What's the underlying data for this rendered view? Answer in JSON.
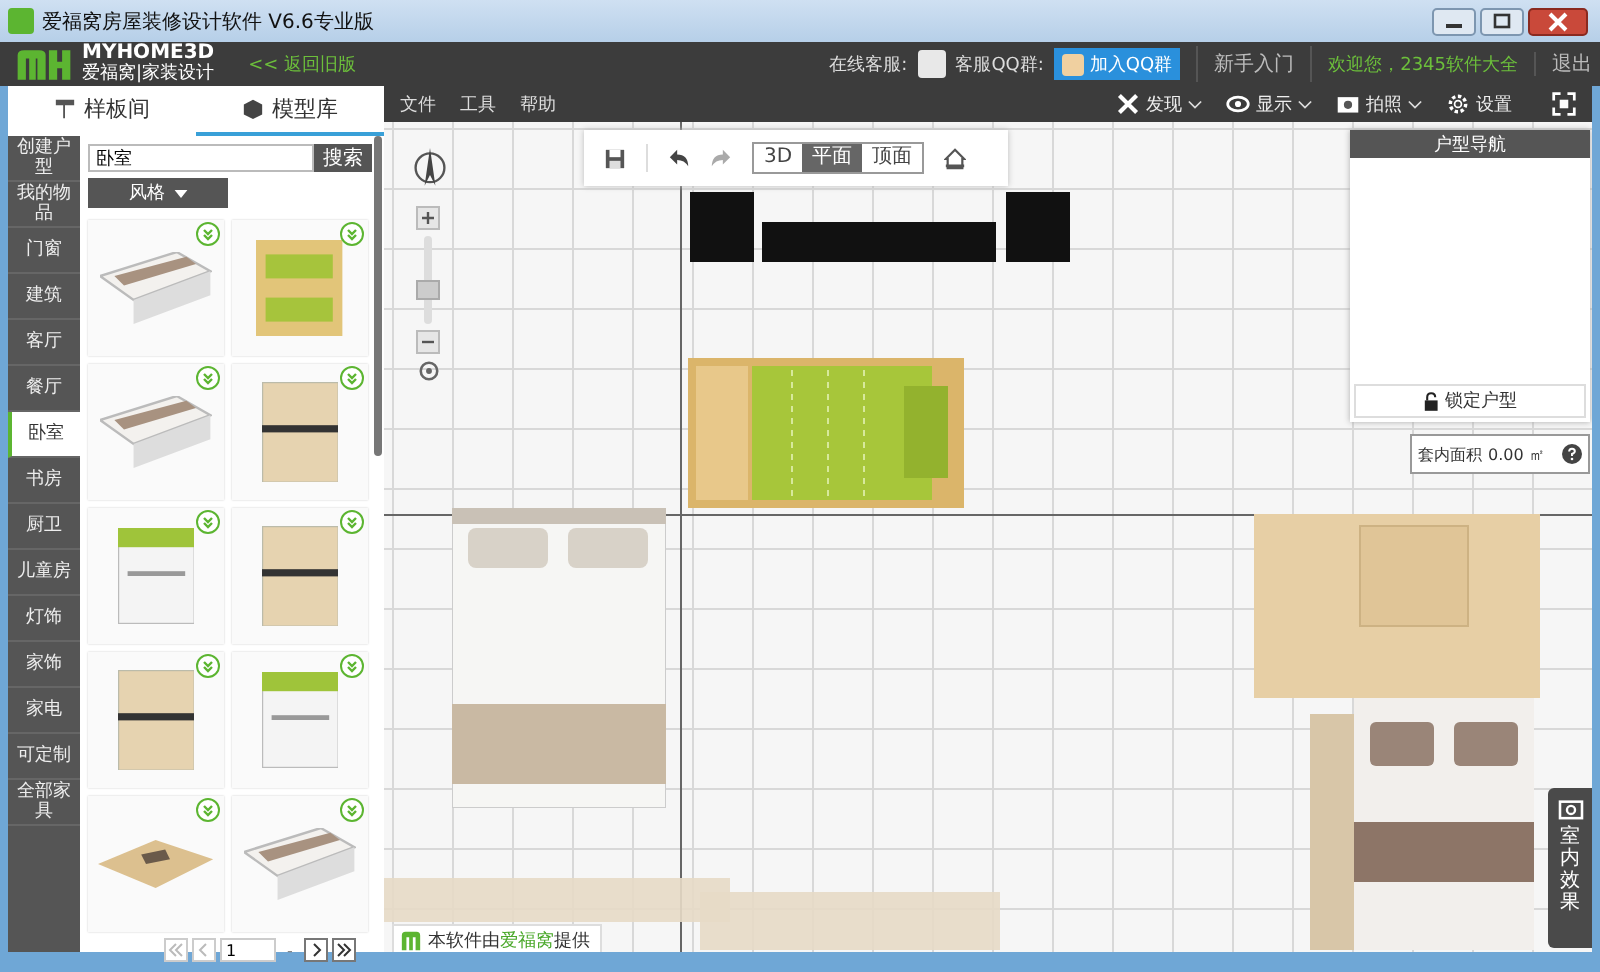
{
  "window": {
    "title": "爱福窝房屋装修设计软件 V6.6专业版"
  },
  "header": {
    "logo_top": "MYHOME3D",
    "logo_bottom": "爱福窝|家装设计",
    "back_link": "<< 返回旧版",
    "service_label": "在线客服:",
    "qq_group_label": "客服QQ群:",
    "join_button": "加入QQ群",
    "guide": "新手入门",
    "welcome": "欢迎您，2345软件大全",
    "logout": "退出"
  },
  "panel_tabs": [
    {
      "label": "样板间",
      "selected": false
    },
    {
      "label": "模型库",
      "selected": true
    }
  ],
  "categories": [
    {
      "label": "创建户型",
      "selected": false
    },
    {
      "label": "我的物品",
      "selected": false
    },
    {
      "label": "门窗",
      "selected": false
    },
    {
      "label": "建筑",
      "selected": false
    },
    {
      "label": "客厅",
      "selected": false
    },
    {
      "label": "餐厅",
      "selected": false
    },
    {
      "label": "卧室",
      "selected": true
    },
    {
      "label": "书房",
      "selected": false
    },
    {
      "label": "厨卫",
      "selected": false
    },
    {
      "label": "儿童房",
      "selected": false
    },
    {
      "label": "灯饰",
      "selected": false
    },
    {
      "label": "家饰",
      "selected": false
    },
    {
      "label": "家电",
      "selected": false
    },
    {
      "label": "可定制",
      "selected": false
    },
    {
      "label": "全部家具",
      "selected": false
    }
  ],
  "search": {
    "value": "卧室",
    "button": "搜索"
  },
  "style_filter": "风格",
  "models": [
    {
      "kind": "bed"
    },
    {
      "kind": "bunk"
    },
    {
      "kind": "bed"
    },
    {
      "kind": "wardrobe"
    },
    {
      "kind": "cabinet"
    },
    {
      "kind": "wardrobe"
    },
    {
      "kind": "wardrobe"
    },
    {
      "kind": "cabinet"
    },
    {
      "kind": "table"
    },
    {
      "kind": "bed"
    }
  ],
  "zoom": {
    "level": 0.35
  },
  "pagination": {
    "page": "1",
    "separator": "-"
  },
  "menu": [
    "文件",
    "工具",
    "帮助"
  ],
  "tools": [
    {
      "label": "发现",
      "kind": "tools"
    },
    {
      "label": "显示",
      "kind": "eye"
    },
    {
      "label": "拍照",
      "kind": "camera"
    },
    {
      "label": "设置",
      "kind": "gear"
    }
  ],
  "view_modes": [
    {
      "label": "3D",
      "selected": false
    },
    {
      "label": "平面",
      "selected": true
    },
    {
      "label": "顶面",
      "selected": false
    }
  ],
  "navigator": {
    "title": "户型导航",
    "lock_button": "锁定户型"
  },
  "area": {
    "label": "套内面积",
    "value": "0.00 ㎡"
  },
  "effect_tab": {
    "label": "室内效果"
  },
  "credit": {
    "before": "本软件由",
    "brand": "爱福窝",
    "after": "提供"
  }
}
